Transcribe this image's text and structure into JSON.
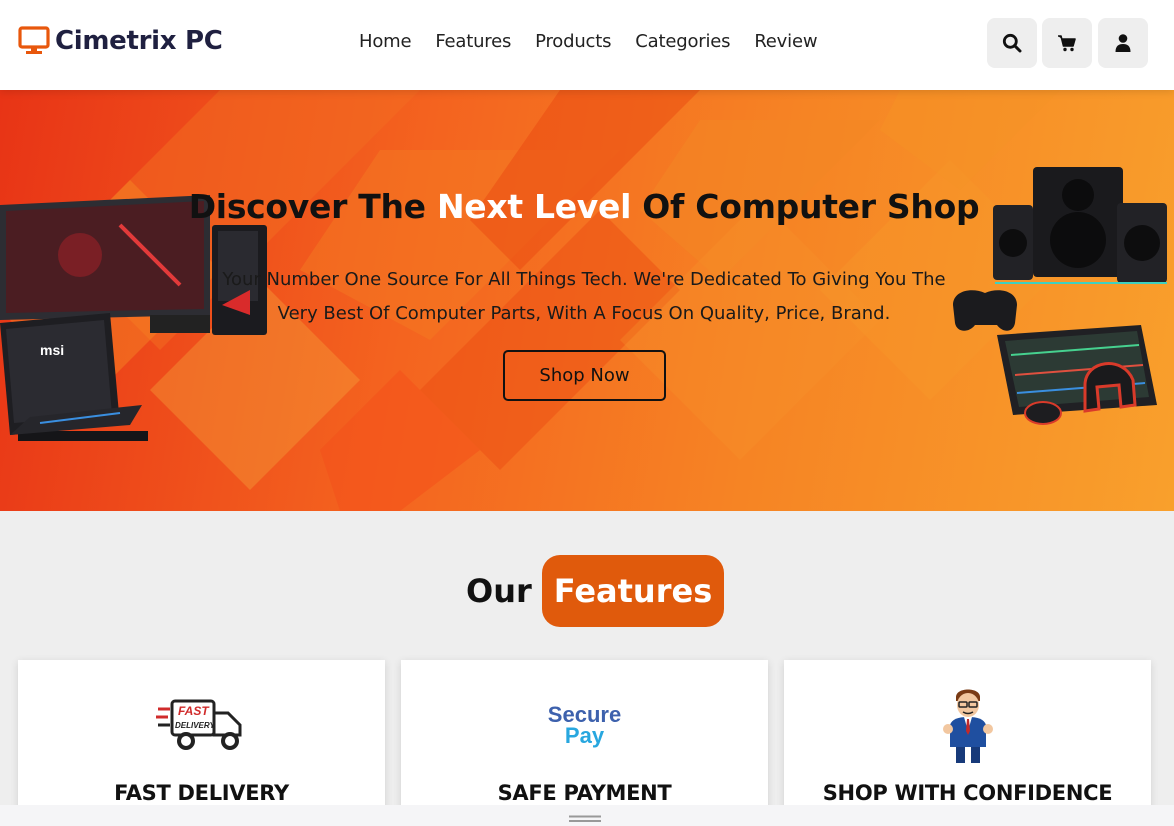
{
  "header": {
    "brand": "Cimetrix PC",
    "logo_icon": "monitor-icon",
    "nav": [
      "Home",
      "Features",
      "Products",
      "Categories",
      "Review"
    ],
    "icons": [
      "search-icon",
      "cart-icon",
      "user-icon"
    ]
  },
  "hero": {
    "title_part1": "Discover The ",
    "title_highlight": "Next Level",
    "title_part2": " Of Computer Shop",
    "description": "Your Number One Source For All Things Tech. We're Dedicated To Giving You The Very Best Of Computer Parts, With A Focus On Quality, Price, Brand.",
    "cta": "Shop Now"
  },
  "features": {
    "heading_plain": "Our",
    "heading_highlight": "Features",
    "cards": [
      {
        "title": "FAST DELIVERY",
        "icon": "fast-delivery-truck-icon",
        "icon_text_1": "FAST",
        "icon_text_2": "DELIVERY"
      },
      {
        "title": "SAFE PAYMENT",
        "icon": "secure-pay-icon",
        "icon_text_1": "Secure",
        "icon_text_2": "Pay"
      },
      {
        "title": "SHOP WITH CONFIDENCE",
        "icon": "businessman-thumbs-up-icon"
      }
    ]
  },
  "colors": {
    "accent": "#e05a0c",
    "hero_start": "#e83416",
    "hero_end": "#f9a02c",
    "brand_text": "#1f2040"
  }
}
